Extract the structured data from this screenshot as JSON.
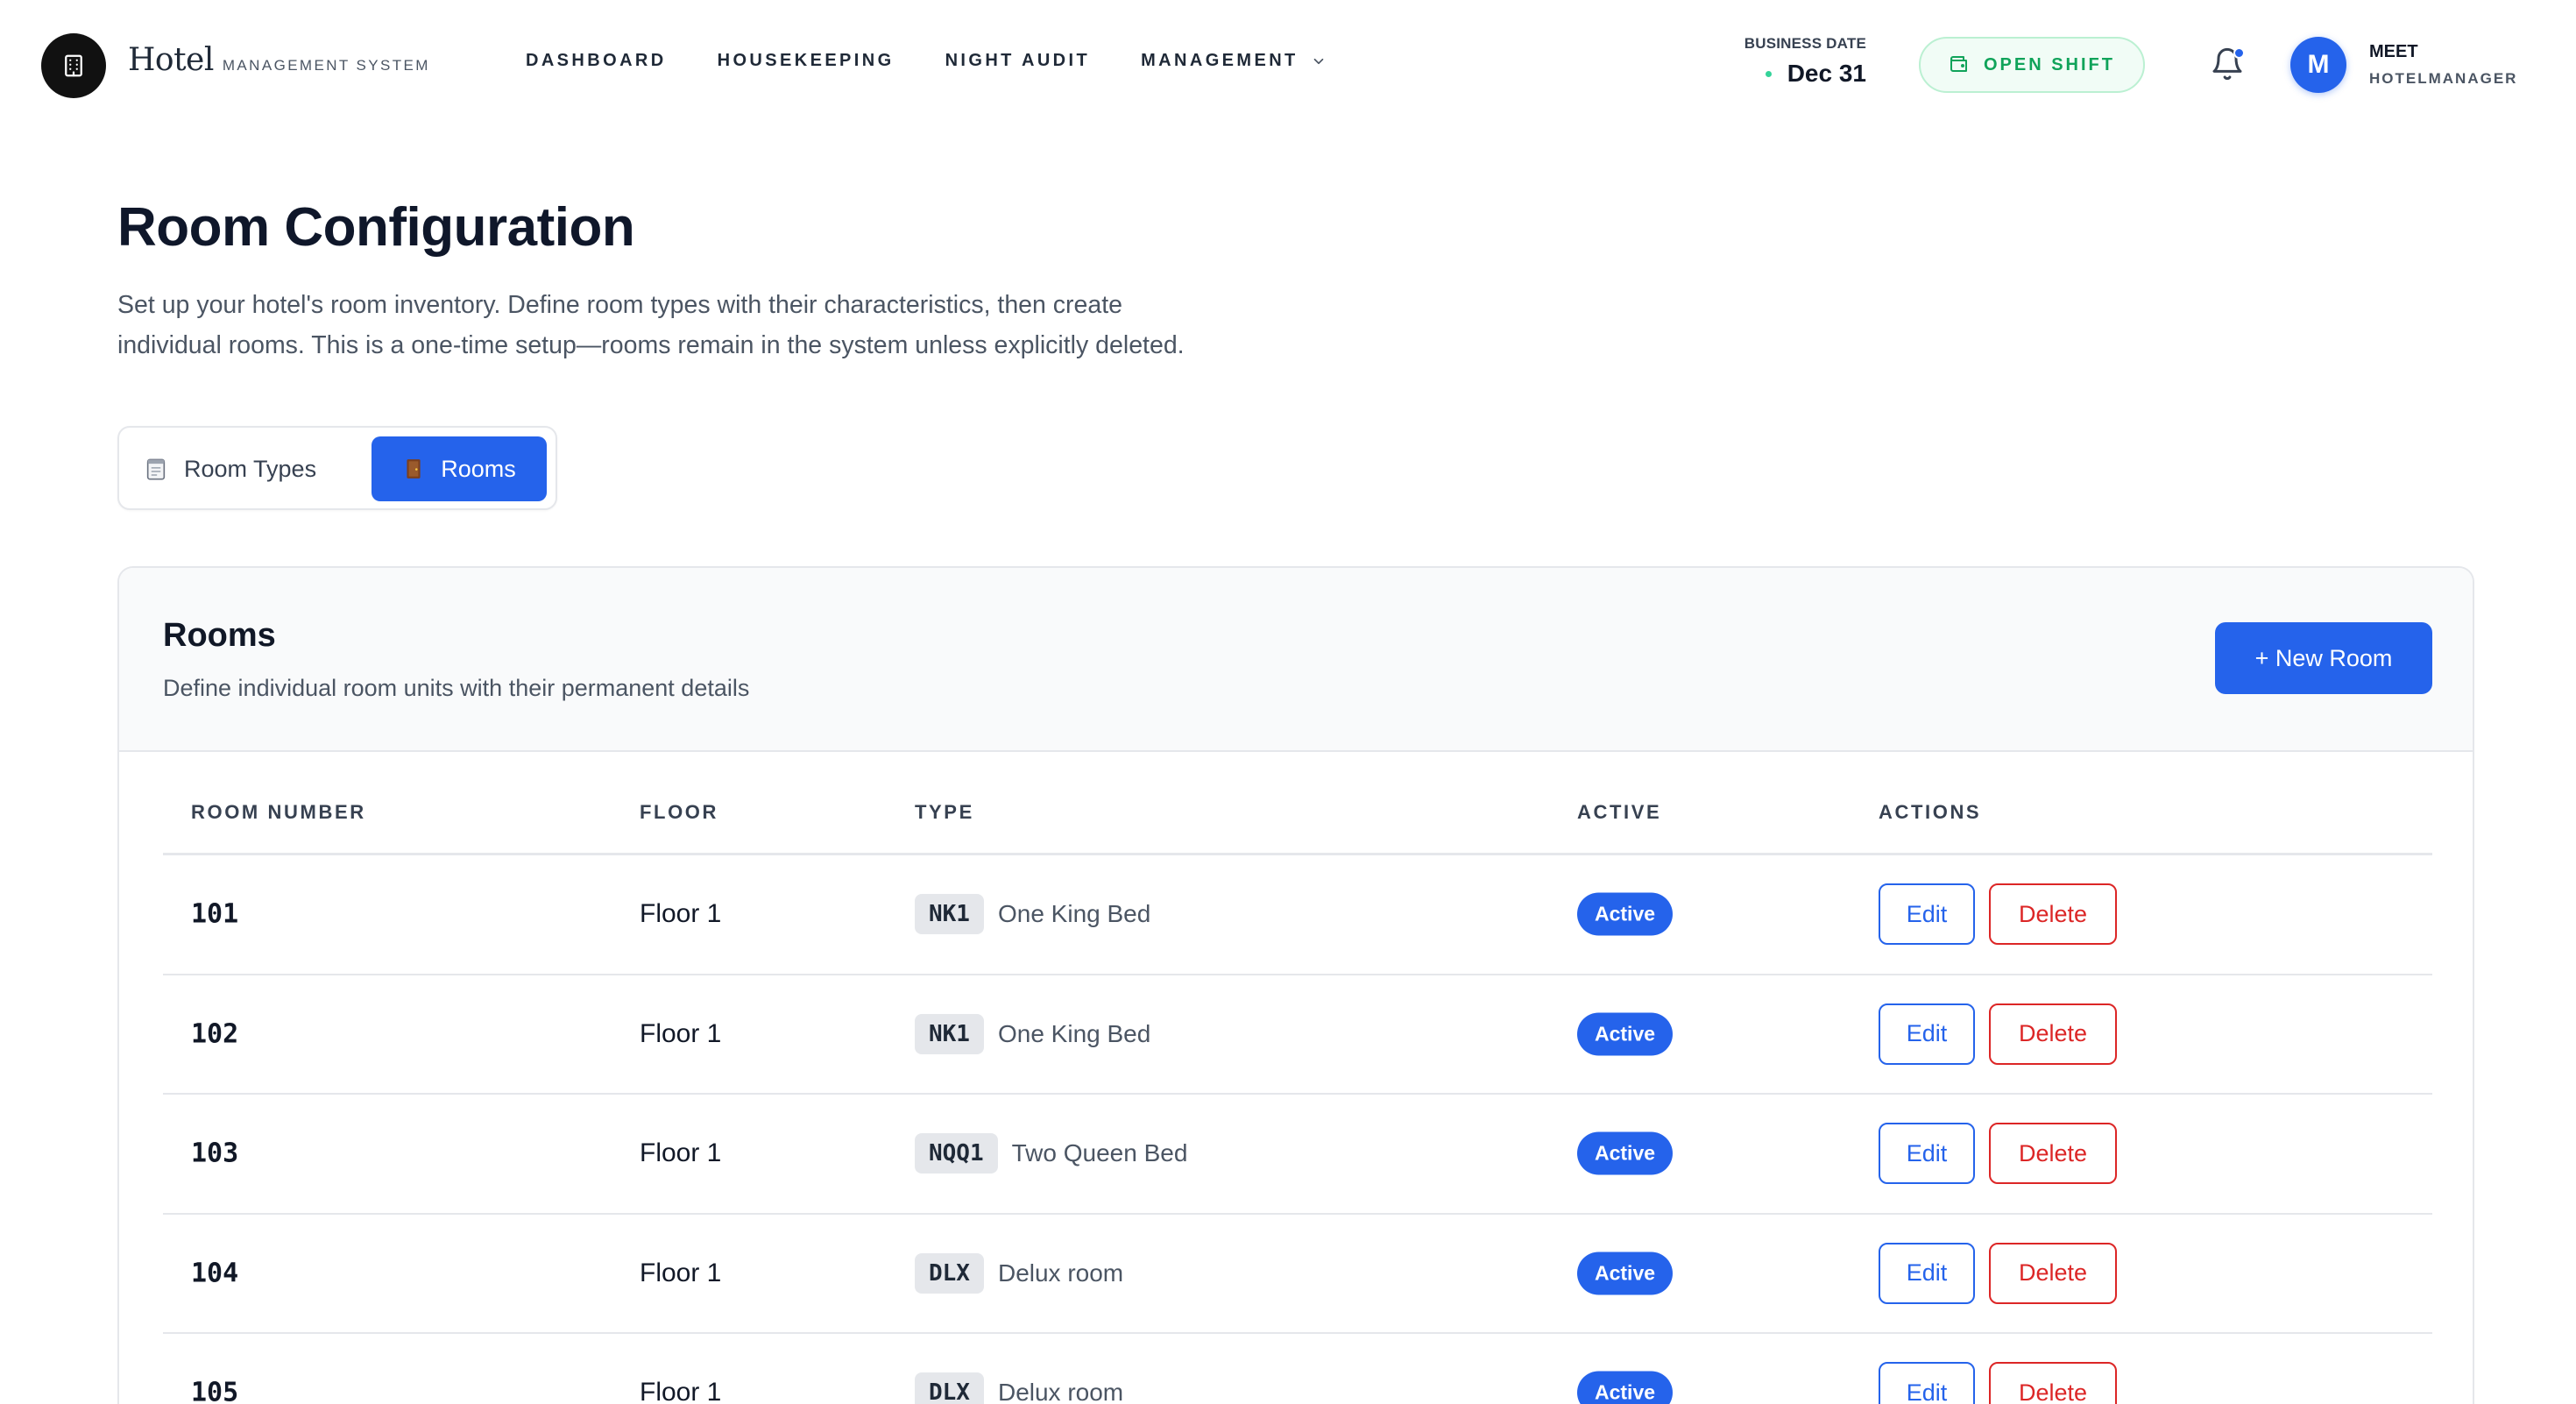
{
  "app": {
    "brand_name": "Hotel",
    "brand_sub": "MANAGEMENT SYSTEM"
  },
  "nav": {
    "items": [
      {
        "label": "DASHBOARD"
      },
      {
        "label": "HOUSEKEEPING"
      },
      {
        "label": "NIGHT AUDIT"
      },
      {
        "label": "MANAGEMENT"
      }
    ]
  },
  "business_date": {
    "label": "BUSINESS DATE",
    "value": "Dec 31"
  },
  "shift": {
    "label": "OPEN SHIFT"
  },
  "user": {
    "initial": "M",
    "name": "MEET",
    "role": "HOTELMANAGER"
  },
  "page": {
    "title": "Room Configuration",
    "description": "Set up your hotel's room inventory. Define room types with their characteristics, then create individual rooms. This is a one-time setup—rooms remain in the system unless explicitly deleted."
  },
  "tabs": [
    {
      "label": "Room Types",
      "active": false
    },
    {
      "label": "Rooms",
      "active": true
    }
  ],
  "rooms_card": {
    "title": "Rooms",
    "subtitle": "Define individual room units with their permanent details",
    "new_button": "+ New Room",
    "columns": [
      "ROOM NUMBER",
      "FLOOR",
      "TYPE",
      "ACTIVE",
      "ACTIONS"
    ],
    "rows": [
      {
        "number": "101",
        "floor": "Floor 1",
        "type_code": "NK1",
        "type_name": "One King Bed",
        "status": "Active",
        "edit": "Edit",
        "delete": "Delete"
      },
      {
        "number": "102",
        "floor": "Floor 1",
        "type_code": "NK1",
        "type_name": "One King Bed",
        "status": "Active",
        "edit": "Edit",
        "delete": "Delete"
      },
      {
        "number": "103",
        "floor": "Floor 1",
        "type_code": "NQQ1",
        "type_name": "Two Queen Bed",
        "status": "Active",
        "edit": "Edit",
        "delete": "Delete"
      },
      {
        "number": "104",
        "floor": "Floor 1",
        "type_code": "DLX",
        "type_name": "Delux room",
        "status": "Active",
        "edit": "Edit",
        "delete": "Delete"
      },
      {
        "number": "105",
        "floor": "Floor 1",
        "type_code": "DLX",
        "type_name": "Delux room",
        "status": "Active",
        "edit": "Edit",
        "delete": "Delete"
      }
    ]
  },
  "colors": {
    "accent": "#2563eb",
    "danger": "#dc2626",
    "success": "#10a35a"
  },
  "icons": {
    "logo": "building-icon",
    "nav_dropdown": "chevron-down-icon",
    "shift": "wallet-icon",
    "notifications": "bell-icon",
    "tab_room_types": "clipboard-icon",
    "tab_rooms": "door-icon"
  }
}
